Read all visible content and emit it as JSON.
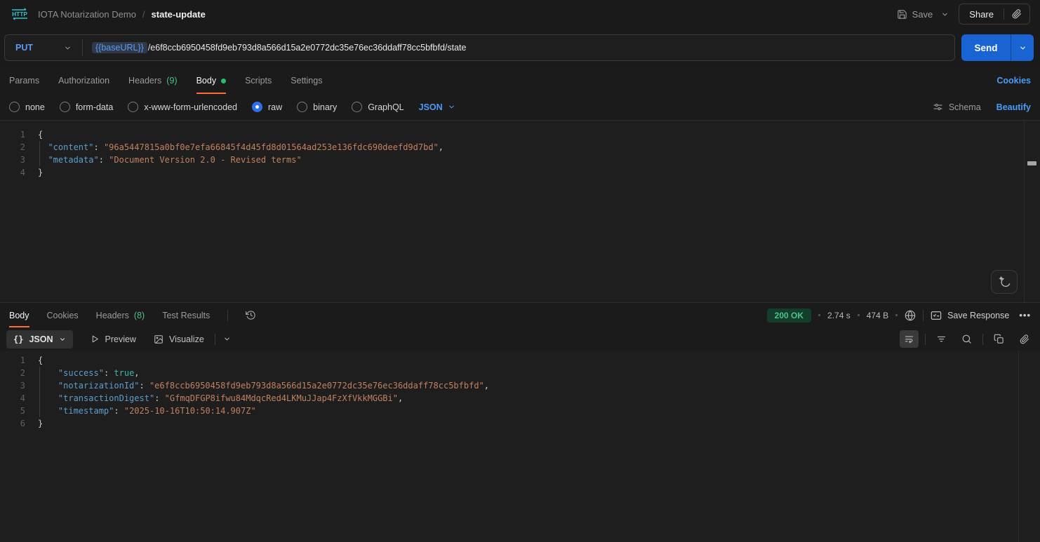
{
  "colors": {
    "accent_orange": "#ff6c37",
    "link_blue": "#4a9cf8",
    "method_blue": "#5a9cf3",
    "send_blue": "#1a63d3",
    "success_green": "#4cc38a",
    "modified_dot_green": "#23c16b",
    "logo_teal": "#2ec5cf"
  },
  "header": {
    "app": "HTTP",
    "collection": "IOTA Notarization Demo",
    "separator": "/",
    "request": "state-update",
    "save": "Save",
    "share": "Share"
  },
  "request": {
    "method": "PUT",
    "base_url_var": "{{baseURL}}",
    "path": "/e6f8ccb6950458fd9eb793d8a566d15a2e0772dc35e76ec36ddaff78cc5bfbfd/state",
    "send": "Send",
    "tabs": {
      "params": "Params",
      "authorization": "Authorization",
      "headers": "Headers",
      "headers_count": "(9)",
      "body": "Body",
      "scripts": "Scripts",
      "settings": "Settings"
    },
    "cookies": "Cookies",
    "modes": {
      "none": "none",
      "form_data": "form-data",
      "urlencoded": "x-www-form-urlencoded",
      "raw": "raw",
      "binary": "binary",
      "graphql": "GraphQL"
    },
    "selected_mode": "raw",
    "language": "JSON",
    "schema": "Schema",
    "beautify": "Beautify",
    "editor_lines": [
      {
        "n": "1",
        "t": [
          [
            "p",
            "{"
          ]
        ]
      },
      {
        "n": "2",
        "t": [
          [
            "p",
            "  "
          ],
          [
            "key",
            "\"content\""
          ],
          [
            "p",
            ": "
          ],
          [
            "str",
            "\"96a5447815a0bf0e7efa66845f4d45fd8d01564ad253e136fdc690deefd9d7bd\""
          ],
          [
            "p",
            ","
          ]
        ]
      },
      {
        "n": "3",
        "t": [
          [
            "p",
            "  "
          ],
          [
            "key",
            "\"metadata\""
          ],
          [
            "p",
            ": "
          ],
          [
            "str",
            "\"Document Version 2.0 - Revised terms\""
          ]
        ]
      },
      {
        "n": "4",
        "t": [
          [
            "p",
            "}"
          ]
        ]
      }
    ]
  },
  "response": {
    "tabs": {
      "body": "Body",
      "cookies": "Cookies",
      "headers": "Headers",
      "headers_count": "(8)",
      "test_results": "Test Results"
    },
    "status": "200 OK",
    "time": "2.74 s",
    "size": "474 B",
    "save_response": "Save Response",
    "more": "•••",
    "format": "JSON",
    "preview": "Preview",
    "visualize": "Visualize",
    "editor_lines": [
      {
        "n": "1",
        "t": [
          [
            "p",
            "{"
          ]
        ]
      },
      {
        "n": "2",
        "t": [
          [
            "p",
            "    "
          ],
          [
            "key",
            "\"success\""
          ],
          [
            "p",
            ": "
          ],
          [
            "bool",
            "true"
          ],
          [
            "p",
            ","
          ]
        ]
      },
      {
        "n": "3",
        "t": [
          [
            "p",
            "    "
          ],
          [
            "key",
            "\"notarizationId\""
          ],
          [
            "p",
            ": "
          ],
          [
            "str",
            "\"e6f8ccb6950458fd9eb793d8a566d15a2e0772dc35e76ec36ddaff78cc5bfbfd\""
          ],
          [
            "p",
            ","
          ]
        ]
      },
      {
        "n": "4",
        "t": [
          [
            "p",
            "    "
          ],
          [
            "key",
            "\"transactionDigest\""
          ],
          [
            "p",
            ": "
          ],
          [
            "str",
            "\"GfmqDFGP8ifwu84MdqcRed4LKMuJJap4FzXfVkkMGGBi\""
          ],
          [
            "p",
            ","
          ]
        ]
      },
      {
        "n": "5",
        "t": [
          [
            "p",
            "    "
          ],
          [
            "key",
            "\"timestamp\""
          ],
          [
            "p",
            ": "
          ],
          [
            "str",
            "\"2025-10-16T10:50:14.907Z\""
          ]
        ]
      },
      {
        "n": "6",
        "t": [
          [
            "p",
            "}"
          ]
        ]
      }
    ]
  }
}
